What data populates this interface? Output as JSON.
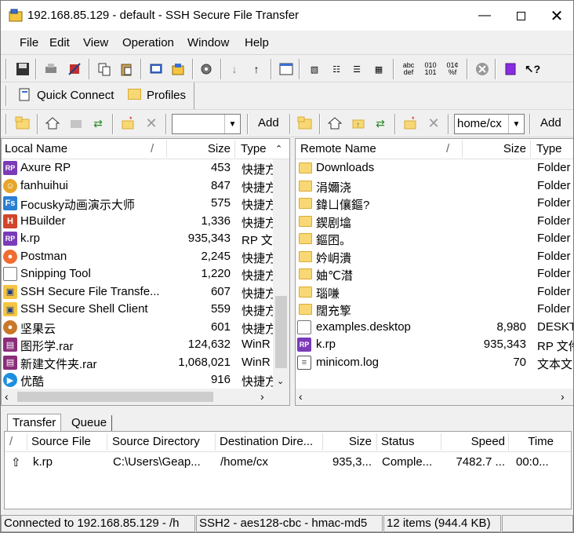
{
  "window": {
    "title": "192.168.85.129 - default - SSH Secure File Transfer"
  },
  "menu": [
    "File",
    "Edit",
    "View",
    "Operation",
    "Window",
    "Help"
  ],
  "quick": {
    "connect": "Quick Connect",
    "profiles": "Profiles"
  },
  "local_toolbar": {
    "add": "Add",
    "path": ""
  },
  "remote_toolbar": {
    "add": "Add",
    "path": "home/cx"
  },
  "local": {
    "headers": {
      "name": "Local Name",
      "size": "Size",
      "type": "Type"
    },
    "rows": [
      {
        "name": "Axure RP",
        "size": "453",
        "type": "快捷方",
        "icon": "rp-icon"
      },
      {
        "name": "fanhuihui",
        "size": "847",
        "type": "快捷方",
        "icon": "user-icon"
      },
      {
        "name": "Focusky动画演示大师",
        "size": "575",
        "type": "快捷方",
        "icon": "focusky-icon"
      },
      {
        "name": "HBuilder",
        "size": "1,336",
        "type": "快捷方",
        "icon": "hbuilder-icon"
      },
      {
        "name": "k.rp",
        "size": "935,343",
        "type": "RP 文",
        "icon": "rp-icon"
      },
      {
        "name": "Postman",
        "size": "2,245",
        "type": "快捷方",
        "icon": "postman-icon"
      },
      {
        "name": "Snipping Tool",
        "size": "1,220",
        "type": "快捷方",
        "icon": "file-icon"
      },
      {
        "name": "SSH Secure File Transfe...",
        "size": "607",
        "type": "快捷方",
        "icon": "ssh-icon"
      },
      {
        "name": "SSH Secure Shell Client",
        "size": "559",
        "type": "快捷方",
        "icon": "ssh-icon"
      },
      {
        "name": "坚果云",
        "size": "601",
        "type": "快捷方",
        "icon": "nut-icon"
      },
      {
        "name": "图形学.rar",
        "size": "124,632",
        "type": "WinR",
        "icon": "rar-icon"
      },
      {
        "name": "新建文件夹.rar",
        "size": "1,068,021",
        "type": "WinR",
        "icon": "rar-icon"
      },
      {
        "name": "优酷",
        "size": "916",
        "type": "快捷方",
        "icon": "youku-icon"
      }
    ]
  },
  "remote": {
    "headers": {
      "name": "Remote Name",
      "size": "Size",
      "type": "Type"
    },
    "rows": [
      {
        "name": "Downloads",
        "size": "",
        "type": "Folder",
        "icon": "folder-icon"
      },
      {
        "name": "涓嬭浇",
        "size": "",
        "type": "Folder",
        "icon": "folder-icon"
      },
      {
        "name": "鍏ㄩ儴鏂?",
        "size": "",
        "type": "Folder",
        "icon": "folder-icon"
      },
      {
        "name": "鍥剧墖",
        "size": "",
        "type": "Folder",
        "icon": "folder-icon"
      },
      {
        "name": "鏂囨。",
        "size": "",
        "type": "Folder",
        "icon": "folder-icon"
      },
      {
        "name": "妗岄潰",
        "size": "",
        "type": "Folder",
        "icon": "folder-icon"
      },
      {
        "name": "妯℃澘",
        "size": "",
        "type": "Folder",
        "icon": "folder-icon"
      },
      {
        "name": "瑙嗛",
        "size": "",
        "type": "Folder",
        "icon": "folder-icon"
      },
      {
        "name": "闊充箰",
        "size": "",
        "type": "Folder",
        "icon": "folder-icon"
      },
      {
        "name": "examples.desktop",
        "size": "8,980",
        "type": "DESKT",
        "icon": "file-icon"
      },
      {
        "name": "k.rp",
        "size": "935,343",
        "type": "RP 文件",
        "icon": "rp-icon"
      },
      {
        "name": "minicom.log",
        "size": "70",
        "type": "文本文",
        "icon": "text-file-icon"
      }
    ]
  },
  "transfer": {
    "tabs": [
      "Transfer",
      "Queue"
    ],
    "headers": {
      "source_file": "Source File",
      "source_dir": "Source Directory",
      "dest_dir": "Destination Dire...",
      "size": "Size",
      "status": "Status",
      "speed": "Speed",
      "time": "Time"
    },
    "rows": [
      {
        "source_file": "k.rp",
        "source_dir": "C:\\Users\\Geap...",
        "dest_dir": "/home/cx",
        "size": "935,3...",
        "status": "Comple...",
        "speed": "7482.7 ...",
        "time": "00:0..."
      }
    ]
  },
  "statusbar": {
    "connection": "Connected to 192.168.85.129 - /h",
    "cipher": "SSH2 - aes128-cbc - hmac-md5",
    "items": "12 items (944.4 KB)"
  }
}
